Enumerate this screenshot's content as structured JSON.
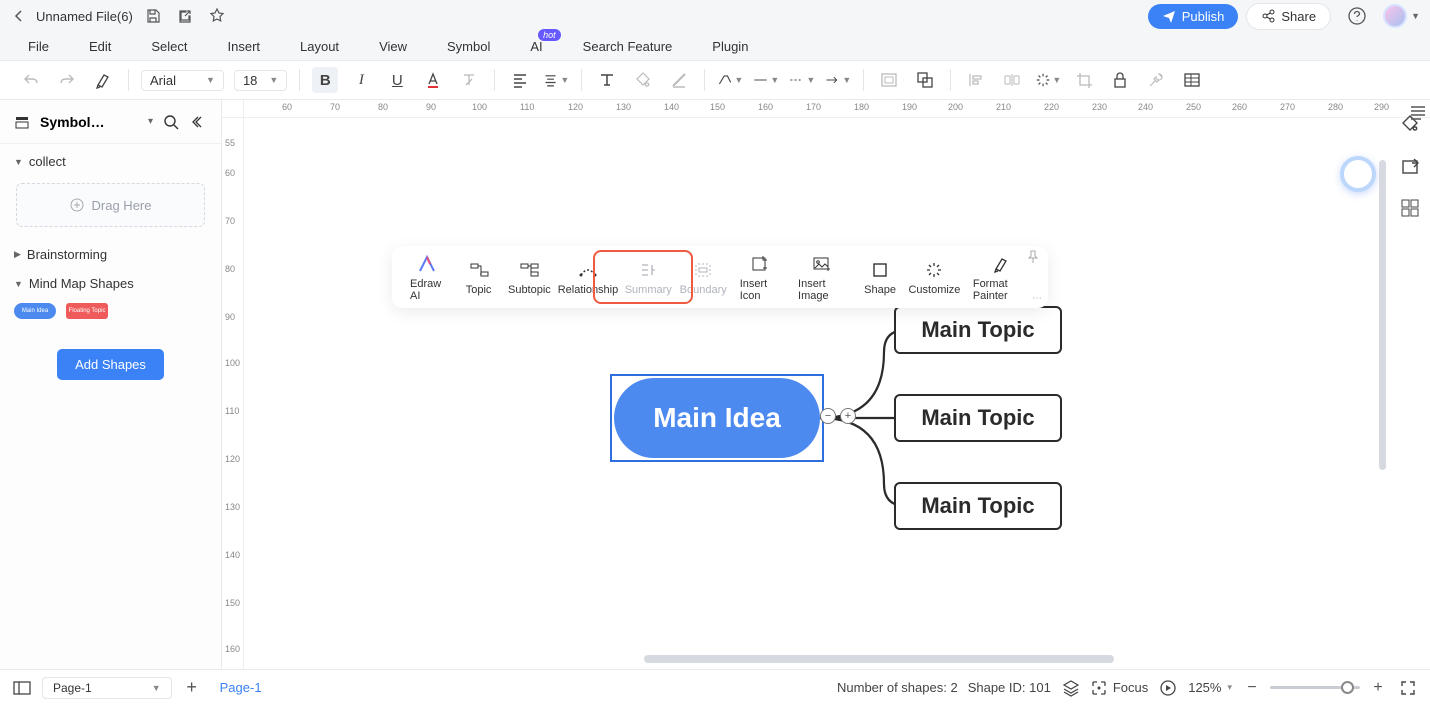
{
  "titlebar": {
    "filename": "Unnamed File(6)",
    "publish": "Publish",
    "share": "Share"
  },
  "menubar": {
    "items": [
      "File",
      "Edit",
      "Select",
      "Insert",
      "Layout",
      "View",
      "Symbol",
      "AI",
      "Search Feature",
      "Plugin"
    ],
    "hot_badge": "hot"
  },
  "toolbar": {
    "font": "Arial",
    "font_size": "18"
  },
  "sidebar": {
    "title": "Symbol…",
    "sections": {
      "collect": "collect",
      "drag_here": "Drag Here",
      "brainstorming": "Brainstorming",
      "mindmap_shapes": "Mind Map Shapes",
      "thumb1": "Main Idea",
      "thumb2": "Floating Topic",
      "add_shapes": "Add Shapes"
    }
  },
  "ruler_h": [
    "60",
    "70",
    "80",
    "90",
    "100",
    "110",
    "120",
    "130",
    "140",
    "150",
    "160",
    "170",
    "180",
    "190",
    "200",
    "210",
    "220",
    "230",
    "240",
    "250",
    "260",
    "270",
    "280",
    "290"
  ],
  "ruler_v": [
    "55",
    "60",
    "70",
    "80",
    "90",
    "100",
    "110",
    "120",
    "130",
    "140",
    "150",
    "160"
  ],
  "ctx_toolbar": {
    "items": [
      "Edraw AI",
      "Topic",
      "Subtopic",
      "Relationship",
      "Summary",
      "Boundary",
      "Insert Icon",
      "Insert Image",
      "Shape",
      "Customize",
      "Format Painter"
    ]
  },
  "mindmap": {
    "main_idea": "Main Idea",
    "topics": [
      "Main Topic",
      "Main Topic",
      "Main Topic"
    ]
  },
  "footer": {
    "page_select": "Page-1",
    "page_tab": "Page-1",
    "shapes_count": "Number of shapes: 2",
    "shape_id": "Shape ID: 101",
    "focus": "Focus",
    "zoom": "125%"
  }
}
